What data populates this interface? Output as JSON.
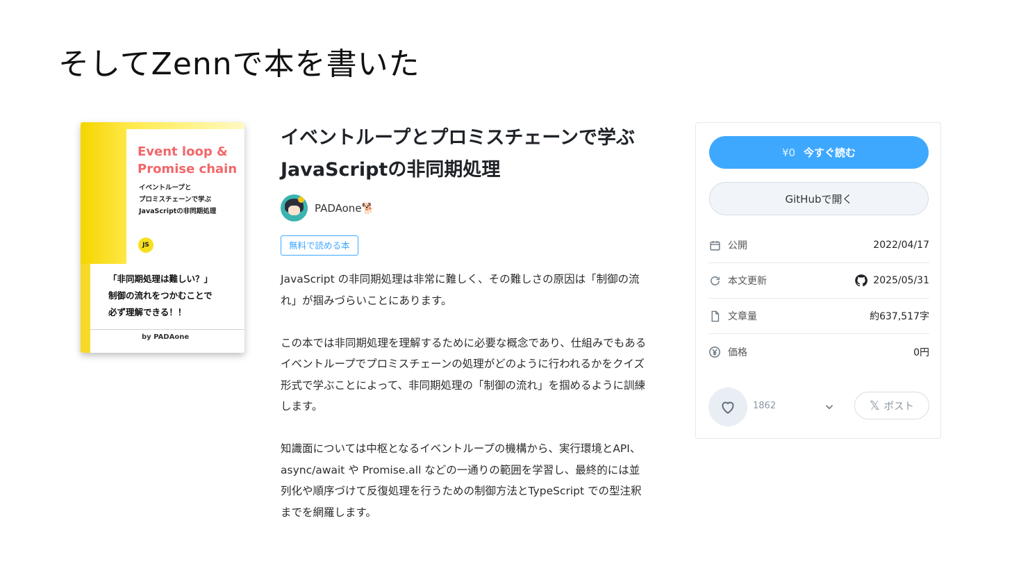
{
  "slide": {
    "title": "そしてZennで本を書いた"
  },
  "cover": {
    "title_en_line1": "Event loop &",
    "title_en_line2": "Promise chain",
    "subtitle_jp": "イベントループと\nプロミスチェーンで学ぶ\nJavaScriptの非同期処理",
    "js_badge": "JS",
    "catch_copy": "「非同期処理は難しい？」\n制御の流れをつかむことで\n必ず理解できる！！",
    "byline": "by PADAone"
  },
  "book": {
    "title": "イベントループとプロミスチェーンで学ぶJavaScriptの非同期処理",
    "author": "PADAone🐕",
    "free_badge": "無料で読める本",
    "description": [
      "JavaScript の非同期処理は非常に難しく、その難しさの原因は「制御の流れ」が掴みづらいことにあります。",
      "この本では非同期処理を理解するために必要な概念であり、仕組みでもあるイベントループでプロミスチェーンの処理がどのように行われるかをクイズ形式で学ぶことによって、非同期処理の「制御の流れ」を掴めるように訓練します。",
      "知識面については中枢となるイベントループの機構から、実行環境とAPI、async/await や Promise.all などの一通りの範囲を学習し、最終的には並列化や順序づけて反復処理を行うための制御方法とTypeScript での型注釈までを網羅します。"
    ]
  },
  "sidebar": {
    "read_price": "¥0",
    "read_label": "今すぐ読む",
    "github_label": "GitHubで開く",
    "meta": [
      {
        "icon": "calendar-icon",
        "label": "公開",
        "value": "2022/04/17"
      },
      {
        "icon": "refresh-icon",
        "label": "本文更新",
        "value": "2025/05/31"
      },
      {
        "icon": "document-icon",
        "label": "文章量",
        "value": "約637,517字"
      },
      {
        "icon": "yen-icon",
        "label": "価格",
        "value": "0円"
      }
    ],
    "likes": "1862",
    "post_label": "ポスト"
  },
  "colors": {
    "accent": "#3ea8ff",
    "cover_title": "#f2676a",
    "cover_yellow": "#f7d928"
  }
}
